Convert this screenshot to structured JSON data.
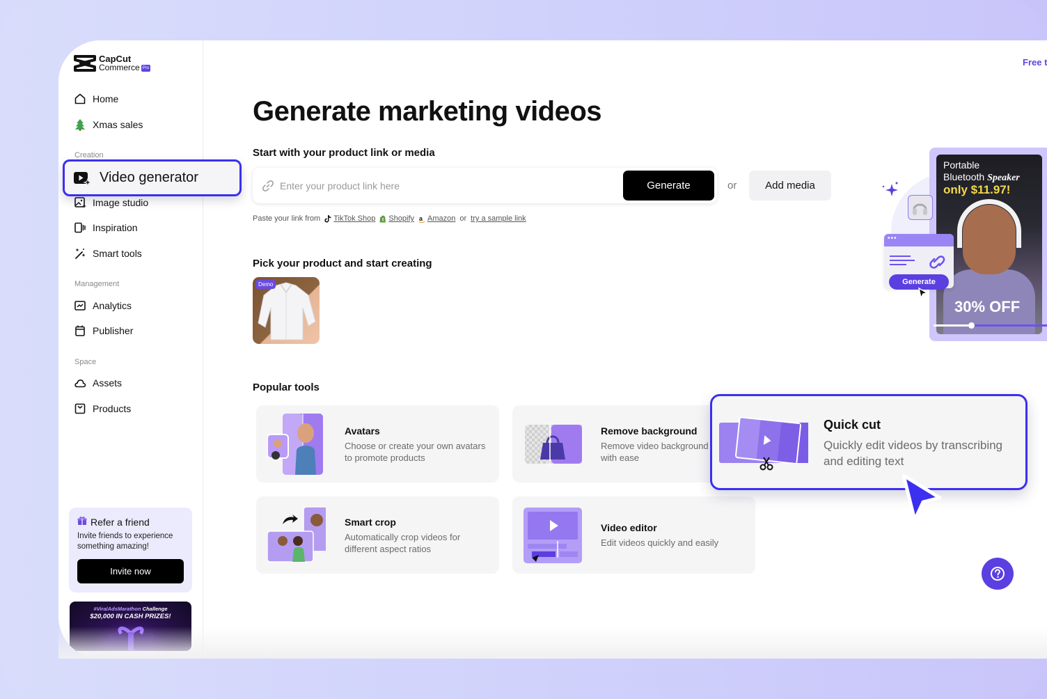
{
  "brand": {
    "name_line1": "CapCut",
    "name_line2": "Commerce",
    "badge": "Pro"
  },
  "sidebar": {
    "top_items": [
      {
        "label": "Home",
        "icon": "home-icon"
      },
      {
        "label": "Xmas sales",
        "icon": "tree-icon"
      }
    ],
    "sections": [
      {
        "title": "Creation",
        "items": [
          {
            "label": "Video generator",
            "icon": "video-generator-icon",
            "active": true
          },
          {
            "label": "Image studio",
            "icon": "image-studio-icon"
          },
          {
            "label": "Inspiration",
            "icon": "inspiration-icon"
          },
          {
            "label": "Smart tools",
            "icon": "magic-wand-icon"
          }
        ]
      },
      {
        "title": "Management",
        "items": [
          {
            "label": "Analytics",
            "icon": "analytics-icon"
          },
          {
            "label": "Publisher",
            "icon": "calendar-icon"
          }
        ]
      },
      {
        "title": "Space",
        "items": [
          {
            "label": "Assets",
            "icon": "cloud-icon"
          },
          {
            "label": "Products",
            "icon": "box-icon"
          }
        ]
      }
    ],
    "refer": {
      "title": "Refer a friend",
      "description": "Invite friends to experience something amazing!",
      "button": "Invite now"
    },
    "promo": {
      "hashtag": "#ViralAdsMarathon",
      "challenge": "Challenge",
      "prize": "$20,000 IN CASH PRIZES!"
    }
  },
  "header": {
    "free_link": "Free t"
  },
  "main": {
    "title": "Generate marketing videos",
    "link_section": {
      "title": "Start with your product link or media",
      "input_placeholder": "Enter your product link here",
      "input_value": "",
      "generate_button": "Generate",
      "or_text": "or",
      "add_media_button": "Add media",
      "paste_prefix": "Paste your link from",
      "sources": [
        {
          "label": "TikTok Shop",
          "icon": "tiktok-icon"
        },
        {
          "label": "Shopify",
          "icon": "shopify-icon"
        },
        {
          "label": "Amazon",
          "icon": "amazon-icon"
        }
      ],
      "sources_or": "or",
      "sample_link": "try a sample link"
    },
    "product_section": {
      "title": "Pick your product and start creating",
      "products": [
        {
          "badge": "Demo",
          "name": "White shirt"
        }
      ]
    },
    "tools_section": {
      "title": "Popular tools",
      "tools": [
        {
          "title": "Avatars",
          "description": "Choose or create your own avatars to promote products"
        },
        {
          "title": "Remove background",
          "description": "Remove video background with ease"
        },
        {
          "title": "Quick cut",
          "description": "Quickly edit videos by transcribing and editing text",
          "highlighted": true
        },
        {
          "title": "Smart crop",
          "description": "Automatically crop videos for different aspect ratios"
        },
        {
          "title": "Video editor",
          "description": "Edit videos quickly and easily"
        }
      ]
    },
    "hero": {
      "line1": "Portable",
      "line2a": "Bluetooth",
      "line2b": "Speaker",
      "price": "only $11.97!",
      "discount": "30% OFF",
      "generate_label": "Generate",
      "window_dots": "•••",
      "progress": 0.32
    },
    "help_icon": "help-icon"
  },
  "colors": {
    "accent": "#5b3fe0",
    "highlight_border": "#3b2ff0",
    "price_yellow": "#f4d94a"
  }
}
